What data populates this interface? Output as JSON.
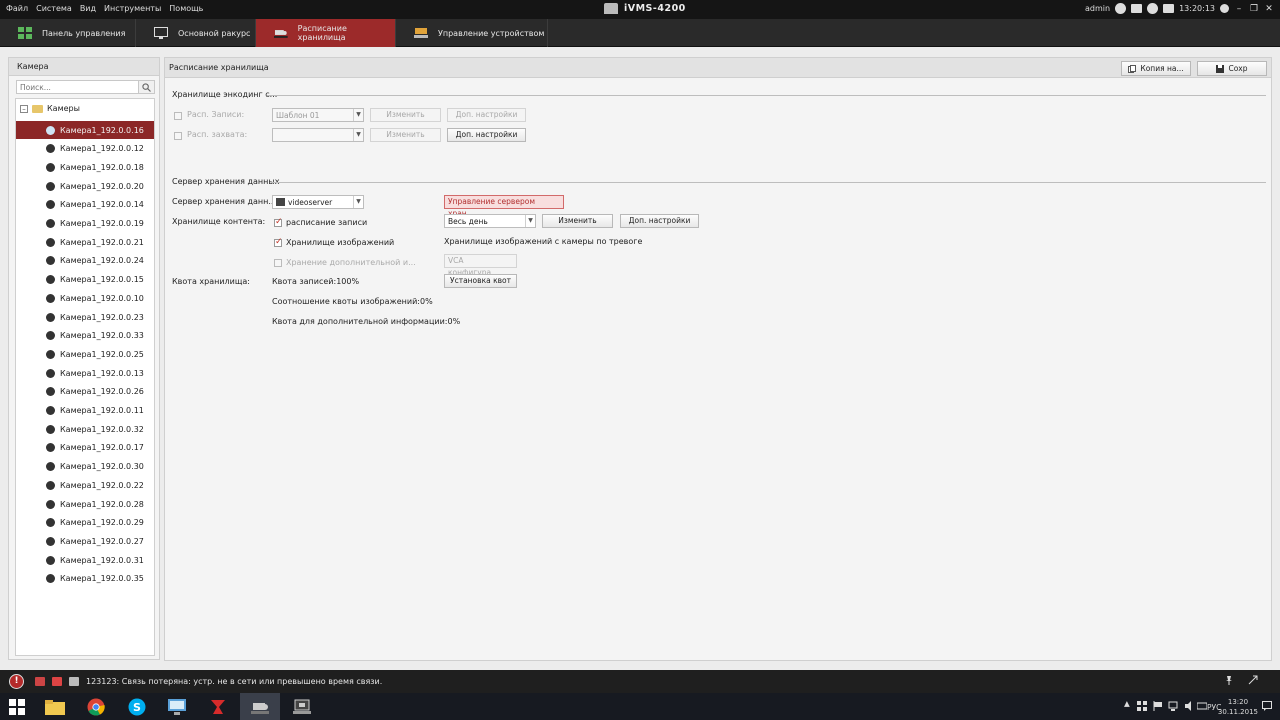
{
  "menu": {
    "file": "Файл",
    "system": "Система",
    "view": "Вид",
    "tools": "Инструменты",
    "help": "Помощь"
  },
  "app_title": "iVMS-4200",
  "user": "admin",
  "time": "13:20:13",
  "tabs": [
    {
      "label": "Панель управления"
    },
    {
      "label": "Основной ракурс"
    },
    {
      "label": "Расписание хранилища"
    },
    {
      "label": "Управление устройством"
    }
  ],
  "left": {
    "header": "Камера",
    "search_placeholder": "Поиск...",
    "root": "Камеры",
    "cameras": [
      "Камера1_192.0.0.16",
      "Камера1_192.0.0.12",
      "Камера1_192.0.0.18",
      "Камера1_192.0.0.20",
      "Камера1_192.0.0.14",
      "Камера1_192.0.0.19",
      "Камера1_192.0.0.21",
      "Камера1_192.0.0.24",
      "Камера1_192.0.0.15",
      "Камера1_192.0.0.10",
      "Камера1_192.0.0.23",
      "Камера1_192.0.0.33",
      "Камера1_192.0.0.25",
      "Камера1_192.0.0.13",
      "Камера1_192.0.0.26",
      "Камера1_192.0.0.11",
      "Камера1_192.0.0.32",
      "Камера1_192.0.0.17",
      "Камера1_192.0.0.30",
      "Камера1_192.0.0.22",
      "Камера1_192.0.0.28",
      "Камера1_192.0.0.29",
      "Камера1_192.0.0.27",
      "Камера1_192.0.0.31",
      "Камера1_192.0.0.35"
    ]
  },
  "main": {
    "header": "Расписание хранилища",
    "copy_button": "Копия на...",
    "save_button": "Сохр",
    "encoding": {
      "title": "Хранилище энкодинг с...",
      "rec_label": "Расп. Записи:",
      "rec_template": "Шаблон 01",
      "capture_label": "Расп. захвата:",
      "capture_value": "",
      "edit": "Изменить",
      "advanced": "Доп. настройки"
    },
    "server": {
      "title": "Сервер хранения данных",
      "server_label": "Сервер хранения данн...",
      "server_value": "videoserver",
      "manage_button": "Управление сервером хран...",
      "content_label": "Хранилище контента:",
      "schedule_rec": "расписание записи",
      "schedule_value": "Весь день",
      "edit": "Изменить",
      "advanced": "Доп. настройки",
      "image_storage": "Хранилище изображений",
      "image_alarm": "Хранилище изображений с камеры по тревоге",
      "extra_storage": "Хранение дополнительной и...",
      "vca_button": "VCA конфигура...",
      "quota_label": "Квота хранилища:",
      "quota_rec": "Квота записей:100%",
      "quota_button": "Установка квот",
      "quota_img": "Соотношение квоты изображений:0%",
      "quota_extra": "Квота для дополнительной информации:0%"
    }
  },
  "status": {
    "message": "123123: Связь потеряна: устр. не в сети или превышено время связи."
  },
  "taskbar": {
    "lang": "РУС",
    "clock_time": "13:20",
    "clock_date": "30.11.2015"
  }
}
